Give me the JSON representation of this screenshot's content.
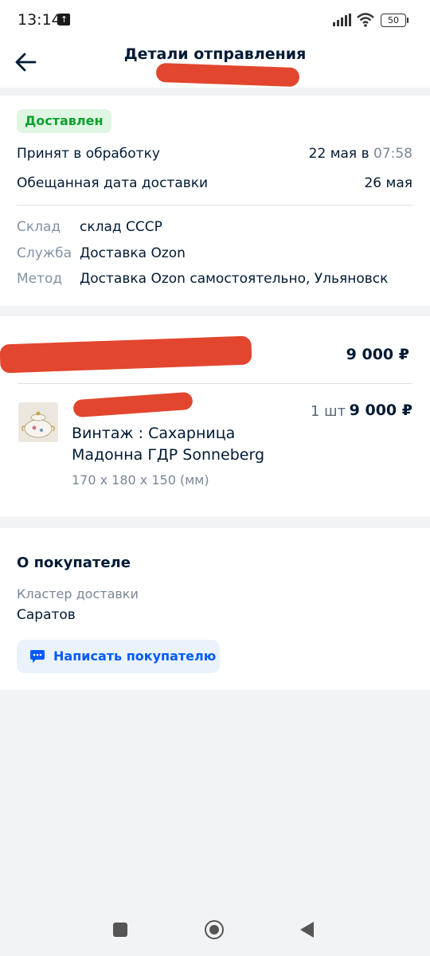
{
  "status_bar": {
    "time": "13:14",
    "battery": "50"
  },
  "header": {
    "title": "Детали отправления"
  },
  "shipment": {
    "status": "Доставлен",
    "accepted_label": "Принят в обработку",
    "accepted_date": "22 мая в ",
    "accepted_time": "07:58",
    "promised_label": "Обещанная дата доставки",
    "promised_date": "26 мая",
    "warehouse_label": "Склад",
    "warehouse_value": "склад СССР",
    "service_label": "Служба",
    "service_value": "Доставка Ozon",
    "method_label": "Метод",
    "method_value": "Доставка Ozon самостоятельно, Ульяновск"
  },
  "order": {
    "total": "9 000 ₽",
    "items": [
      {
        "name": "Винтаж : Сахарница Мадонна ГДР Sonneberg",
        "dimensions": "170 x 180 x 150 (мм)",
        "quantity": "1 шт",
        "price": "9 000 ₽"
      }
    ]
  },
  "buyer": {
    "title": "О покупателе",
    "cluster_label": "Кластер доставки",
    "cluster_value": "Саратов",
    "message_button": "Написать покупателю"
  },
  "icons": {
    "back": "arrow-left-icon",
    "chat": "chat-bubble-icon"
  },
  "colors": {
    "accent": "#005bff",
    "status_green": "#10a02e",
    "redaction": "#e2462e"
  }
}
